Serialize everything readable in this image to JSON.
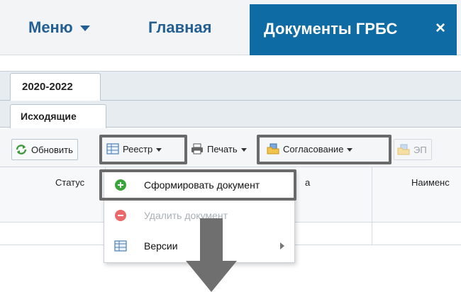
{
  "topnav": {
    "menu_label": "Меню",
    "home_label": "Главная",
    "active_tab_label": "Документы ГРБС",
    "close_symbol": "×"
  },
  "tabs": {
    "year_tab": "2020-2022",
    "sub_tab": "Исходящие"
  },
  "toolbar": {
    "refresh_label": "Обновить",
    "registry_label": "Реестр",
    "print_label": "Печать",
    "approval_label": "Согласование",
    "ep_label": "ЭП"
  },
  "grid": {
    "columns": [
      "Статус",
      "а",
      "Наименс"
    ]
  },
  "dropdown": {
    "items": [
      {
        "label": "Сформировать документ",
        "enabled": true,
        "icon": "plus-circle-icon"
      },
      {
        "label": "Удалить документ",
        "enabled": false,
        "icon": "minus-circle-icon"
      },
      {
        "label": "Версии",
        "enabled": true,
        "icon": "table-icon",
        "submenu": true
      }
    ]
  },
  "colors": {
    "accent_blue": "#0f6ba3",
    "nav_text": "#235f92",
    "highlight": "#6a6a6a",
    "add_green": "#3aa53a",
    "delete_red": "#e86a6a"
  }
}
